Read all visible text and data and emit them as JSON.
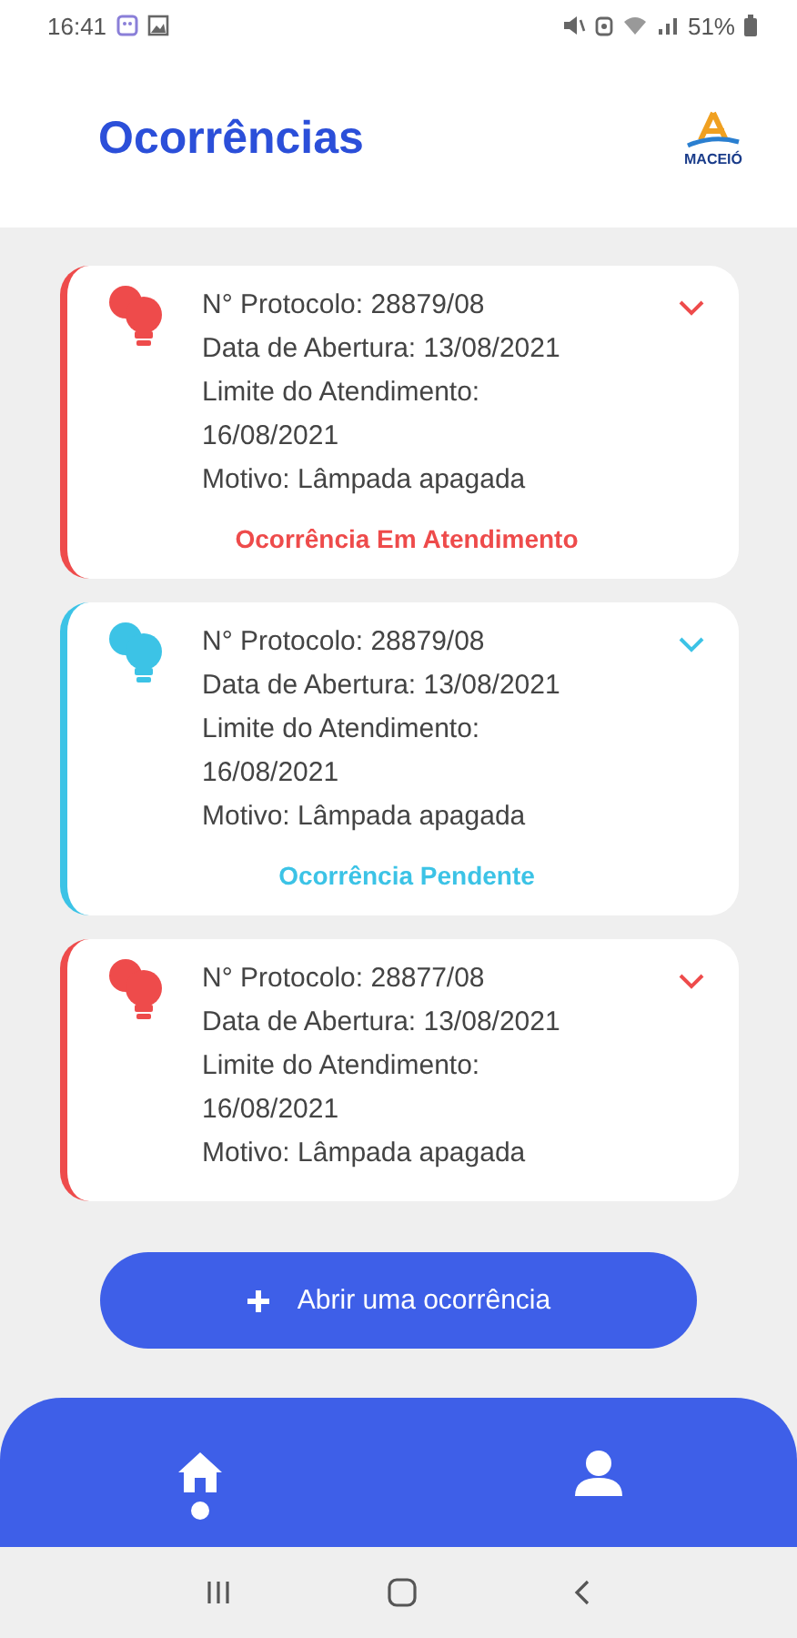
{
  "status_bar": {
    "time": "16:41",
    "battery": "51%"
  },
  "header": {
    "title": "Ocorrências",
    "logo_text": "MACEIÓ"
  },
  "occurrences": [
    {
      "color": "#ee4b4b",
      "expanded": false,
      "lines": [
        "N° Protocolo: 28879/08",
        "Data de Abertura: 13/08/2021",
        "Limite do Atendimento:",
        "16/08/2021",
        "Motivo: Lâmpada apagada"
      ],
      "status": "Ocorrência Em Atendimento"
    },
    {
      "color": "#3cc3e6",
      "expanded": false,
      "lines": [
        "N° Protocolo: 28879/08",
        "Data de Abertura: 13/08/2021",
        "Limite do Atendimento:",
        "16/08/2021",
        "Motivo: Lâmpada apagada"
      ],
      "status": "Ocorrência Pendente"
    },
    {
      "color": "#ee4b4b",
      "expanded": false,
      "lines": [
        "N° Protocolo: 28877/08",
        "Data de Abertura: 13/08/2021",
        "Limite do Atendimento:",
        "16/08/2021",
        "Motivo: Lâmpada apagada"
      ]
    }
  ],
  "action_button": {
    "label": "Abrir uma ocorrência"
  },
  "bottom_nav": [
    {
      "kind": "home",
      "selected": true
    },
    {
      "kind": "profile",
      "selected": false
    }
  ]
}
